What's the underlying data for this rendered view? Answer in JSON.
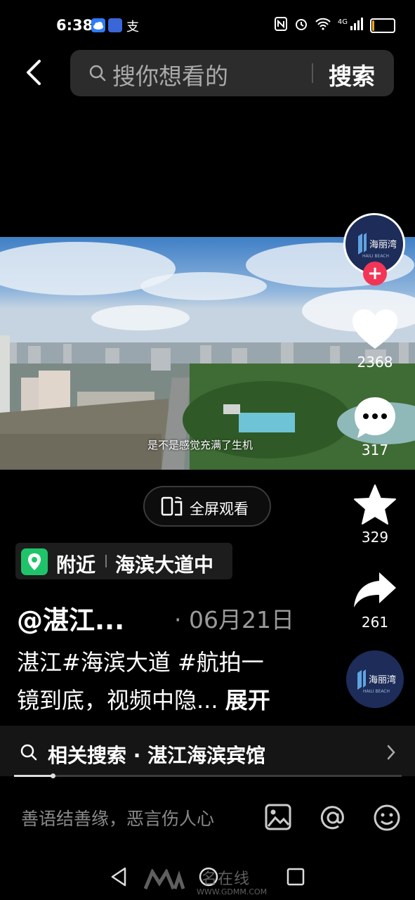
{
  "status_bar": {
    "time": "6:38",
    "network": "4G",
    "battery": "11",
    "battery_level": 0.11,
    "colors": {
      "battery": "#f2a623"
    },
    "icons": [
      "weather-cloud-icon",
      "app-notification-icon",
      "alipay-icon",
      "nfc-icon",
      "alarm-icon",
      "wifi-icon",
      "signal-icon",
      "battery-icon"
    ]
  },
  "header": {
    "search_placeholder": "搜你想看的",
    "search_button": "搜索"
  },
  "video": {
    "caption": "是不是感觉充满了生机"
  },
  "right_rail": {
    "like_count": "2368",
    "comment_count": "317",
    "favorite_count": "329",
    "share_count": "261",
    "colors": {
      "follow": "#f23556"
    }
  },
  "fullscreen_label": "全屏观看",
  "location": {
    "prefix": "附近",
    "place": "海滨大道中",
    "colors": {
      "pin": "#1fc46a"
    }
  },
  "post": {
    "author": "@湛江...",
    "date": "· 06月21日",
    "description_line1": "湛江#海滨大道 #航拍一",
    "description_line2": "镜到底，视频中隐...",
    "expand_label": "展开"
  },
  "related_search": {
    "label": "相关搜索 · 湛江海滨宾馆"
  },
  "progress": 0.1,
  "comment_bar": {
    "placeholder": "善语结善缘，恶言伤人心"
  },
  "watermark": {
    "text": "名在线",
    "url": "WWW.GDMM.COM"
  }
}
